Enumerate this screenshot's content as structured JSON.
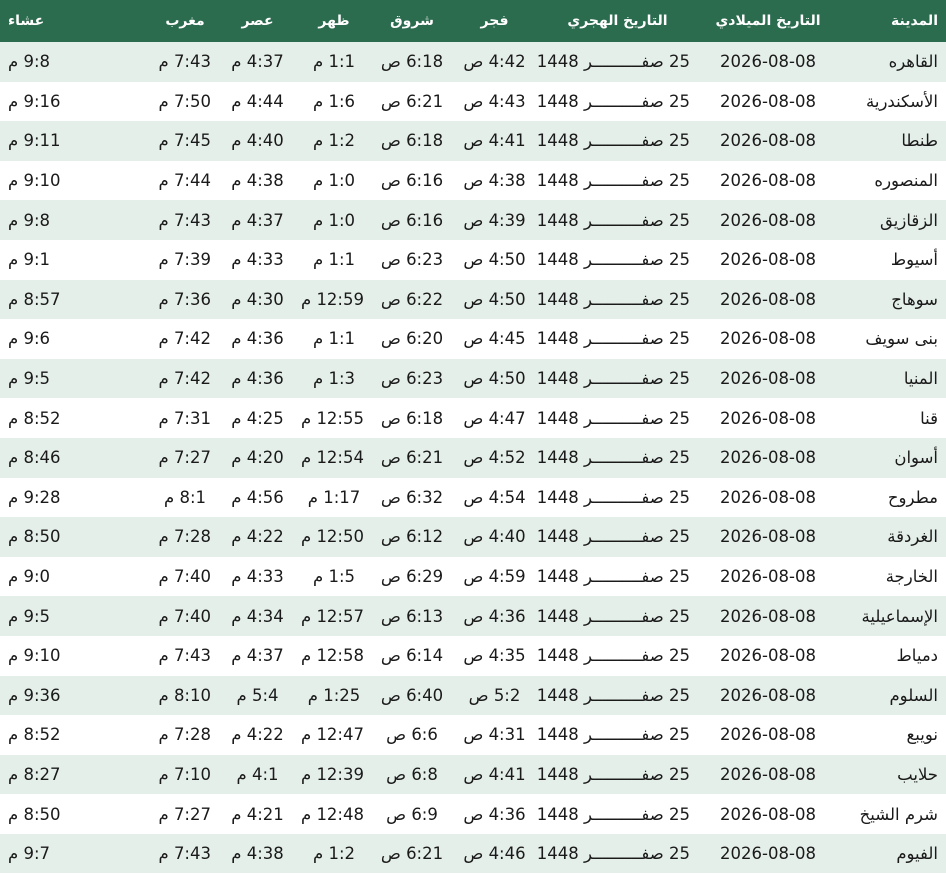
{
  "columns": {
    "city": "المدينة",
    "gregorian": "التاريخ الميلادي",
    "hijri": "التاريخ الهجري",
    "fajr": "فجر",
    "sunrise": "شروق",
    "dhuhr": "ظهر",
    "asr": "عصر",
    "maghrib": "مغرب",
    "isha": "عشاء"
  },
  "rows": [
    {
      "city": "القاهره",
      "gregorian": "2026-08-08",
      "hijri": "25 صفــــــــــر 1448",
      "fajr": "4:42 ص",
      "sunrise": "6:18 ص",
      "dhuhr": "1:1 م",
      "asr": "4:37 م",
      "maghrib": "7:43 م",
      "isha": "9:8 م"
    },
    {
      "city": "الأسكندرية",
      "gregorian": "2026-08-08",
      "hijri": "25 صفــــــــــر 1448",
      "fajr": "4:43 ص",
      "sunrise": "6:21 ص",
      "dhuhr": "1:6 م",
      "asr": "4:44 م",
      "maghrib": "7:50 م",
      "isha": "9:16 م"
    },
    {
      "city": "طنطا",
      "gregorian": "2026-08-08",
      "hijri": "25 صفــــــــــر 1448",
      "fajr": "4:41 ص",
      "sunrise": "6:18 ص",
      "dhuhr": "1:2 م",
      "asr": "4:40 م",
      "maghrib": "7:45 م",
      "isha": "9:11 م"
    },
    {
      "city": "المنصوره",
      "gregorian": "2026-08-08",
      "hijri": "25 صفــــــــــر 1448",
      "fajr": "4:38 ص",
      "sunrise": "6:16 ص",
      "dhuhr": "1:0 م",
      "asr": "4:38 م",
      "maghrib": "7:44 م",
      "isha": "9:10 م"
    },
    {
      "city": "الزقازيق",
      "gregorian": "2026-08-08",
      "hijri": "25 صفــــــــــر 1448",
      "fajr": "4:39 ص",
      "sunrise": "6:16 ص",
      "dhuhr": "1:0 م",
      "asr": "4:37 م",
      "maghrib": "7:43 م",
      "isha": "9:8 م"
    },
    {
      "city": "أسيوط",
      "gregorian": "2026-08-08",
      "hijri": "25 صفــــــــــر 1448",
      "fajr": "4:50 ص",
      "sunrise": "6:23 ص",
      "dhuhr": "1:1 م",
      "asr": "4:33 م",
      "maghrib": "7:39 م",
      "isha": "9:1 م"
    },
    {
      "city": "سوهاج",
      "gregorian": "2026-08-08",
      "hijri": "25 صفــــــــــر 1448",
      "fajr": "4:50 ص",
      "sunrise": "6:22 ص",
      "dhuhr": "12:59 م",
      "asr": "4:30 م",
      "maghrib": "7:36 م",
      "isha": "8:57 م"
    },
    {
      "city": "بنى سويف",
      "gregorian": "2026-08-08",
      "hijri": "25 صفــــــــــر 1448",
      "fajr": "4:45 ص",
      "sunrise": "6:20 ص",
      "dhuhr": "1:1 م",
      "asr": "4:36 م",
      "maghrib": "7:42 م",
      "isha": "9:6 م"
    },
    {
      "city": "المنيا",
      "gregorian": "2026-08-08",
      "hijri": "25 صفــــــــــر 1448",
      "fajr": "4:50 ص",
      "sunrise": "6:23 ص",
      "dhuhr": "1:3 م",
      "asr": "4:36 م",
      "maghrib": "7:42 م",
      "isha": "9:5 م"
    },
    {
      "city": "قنا",
      "gregorian": "2026-08-08",
      "hijri": "25 صفــــــــــر 1448",
      "fajr": "4:47 ص",
      "sunrise": "6:18 ص",
      "dhuhr": "12:55 م",
      "asr": "4:25 م",
      "maghrib": "7:31 م",
      "isha": "8:52 م"
    },
    {
      "city": "أسوان",
      "gregorian": "2026-08-08",
      "hijri": "25 صفــــــــــر 1448",
      "fajr": "4:52 ص",
      "sunrise": "6:21 ص",
      "dhuhr": "12:54 م",
      "asr": "4:20 م",
      "maghrib": "7:27 م",
      "isha": "8:46 م"
    },
    {
      "city": "مطروح",
      "gregorian": "2026-08-08",
      "hijri": "25 صفــــــــــر 1448",
      "fajr": "4:54 ص",
      "sunrise": "6:32 ص",
      "dhuhr": "1:17 م",
      "asr": "4:56 م",
      "maghrib": "8:1 م",
      "isha": "9:28 م"
    },
    {
      "city": "الغردقة",
      "gregorian": "2026-08-08",
      "hijri": "25 صفــــــــــر 1448",
      "fajr": "4:40 ص",
      "sunrise": "6:12 ص",
      "dhuhr": "12:50 م",
      "asr": "4:22 م",
      "maghrib": "7:28 م",
      "isha": "8:50 م"
    },
    {
      "city": "الخارجة",
      "gregorian": "2026-08-08",
      "hijri": "25 صفــــــــــر 1448",
      "fajr": "4:59 ص",
      "sunrise": "6:29 ص",
      "dhuhr": "1:5 م",
      "asr": "4:33 م",
      "maghrib": "7:40 م",
      "isha": "9:0 م"
    },
    {
      "city": "الإسماعيلية",
      "gregorian": "2026-08-08",
      "hijri": "25 صفــــــــــر 1448",
      "fajr": "4:36 ص",
      "sunrise": "6:13 ص",
      "dhuhr": "12:57 م",
      "asr": "4:34 م",
      "maghrib": "7:40 م",
      "isha": "9:5 م"
    },
    {
      "city": "دمياط",
      "gregorian": "2026-08-08",
      "hijri": "25 صفــــــــــر 1448",
      "fajr": "4:35 ص",
      "sunrise": "6:14 ص",
      "dhuhr": "12:58 م",
      "asr": "4:37 م",
      "maghrib": "7:43 م",
      "isha": "9:10 م"
    },
    {
      "city": "السلوم",
      "gregorian": "2026-08-08",
      "hijri": "25 صفــــــــــر 1448",
      "fajr": "5:2 ص",
      "sunrise": "6:40 ص",
      "dhuhr": "1:25 م",
      "asr": "5:4 م",
      "maghrib": "8:10 م",
      "isha": "9:36 م"
    },
    {
      "city": "نويبع",
      "gregorian": "2026-08-08",
      "hijri": "25 صفــــــــــر 1448",
      "fajr": "4:31 ص",
      "sunrise": "6:6 ص",
      "dhuhr": "12:47 م",
      "asr": "4:22 م",
      "maghrib": "7:28 م",
      "isha": "8:52 م"
    },
    {
      "city": "حلايب",
      "gregorian": "2026-08-08",
      "hijri": "25 صفــــــــــر 1448",
      "fajr": "4:41 ص",
      "sunrise": "6:8 ص",
      "dhuhr": "12:39 م",
      "asr": "4:1 م",
      "maghrib": "7:10 م",
      "isha": "8:27 م"
    },
    {
      "city": "شرم الشيخ",
      "gregorian": "2026-08-08",
      "hijri": "25 صفــــــــــر 1448",
      "fajr": "4:36 ص",
      "sunrise": "6:9 ص",
      "dhuhr": "12:48 م",
      "asr": "4:21 م",
      "maghrib": "7:27 م",
      "isha": "8:50 م"
    },
    {
      "city": "الفيوم",
      "gregorian": "2026-08-08",
      "hijri": "25 صفــــــــــر 1448",
      "fajr": "4:46 ص",
      "sunrise": "6:21 ص",
      "dhuhr": "1:2 م",
      "asr": "4:38 م",
      "maghrib": "7:43 م",
      "isha": "9:7 م"
    }
  ],
  "colors": {
    "header_bg": "#2b6b4e",
    "header_text": "#ffffff",
    "row_alt_bg": "#e5efea",
    "row_bg": "#ffffff"
  }
}
